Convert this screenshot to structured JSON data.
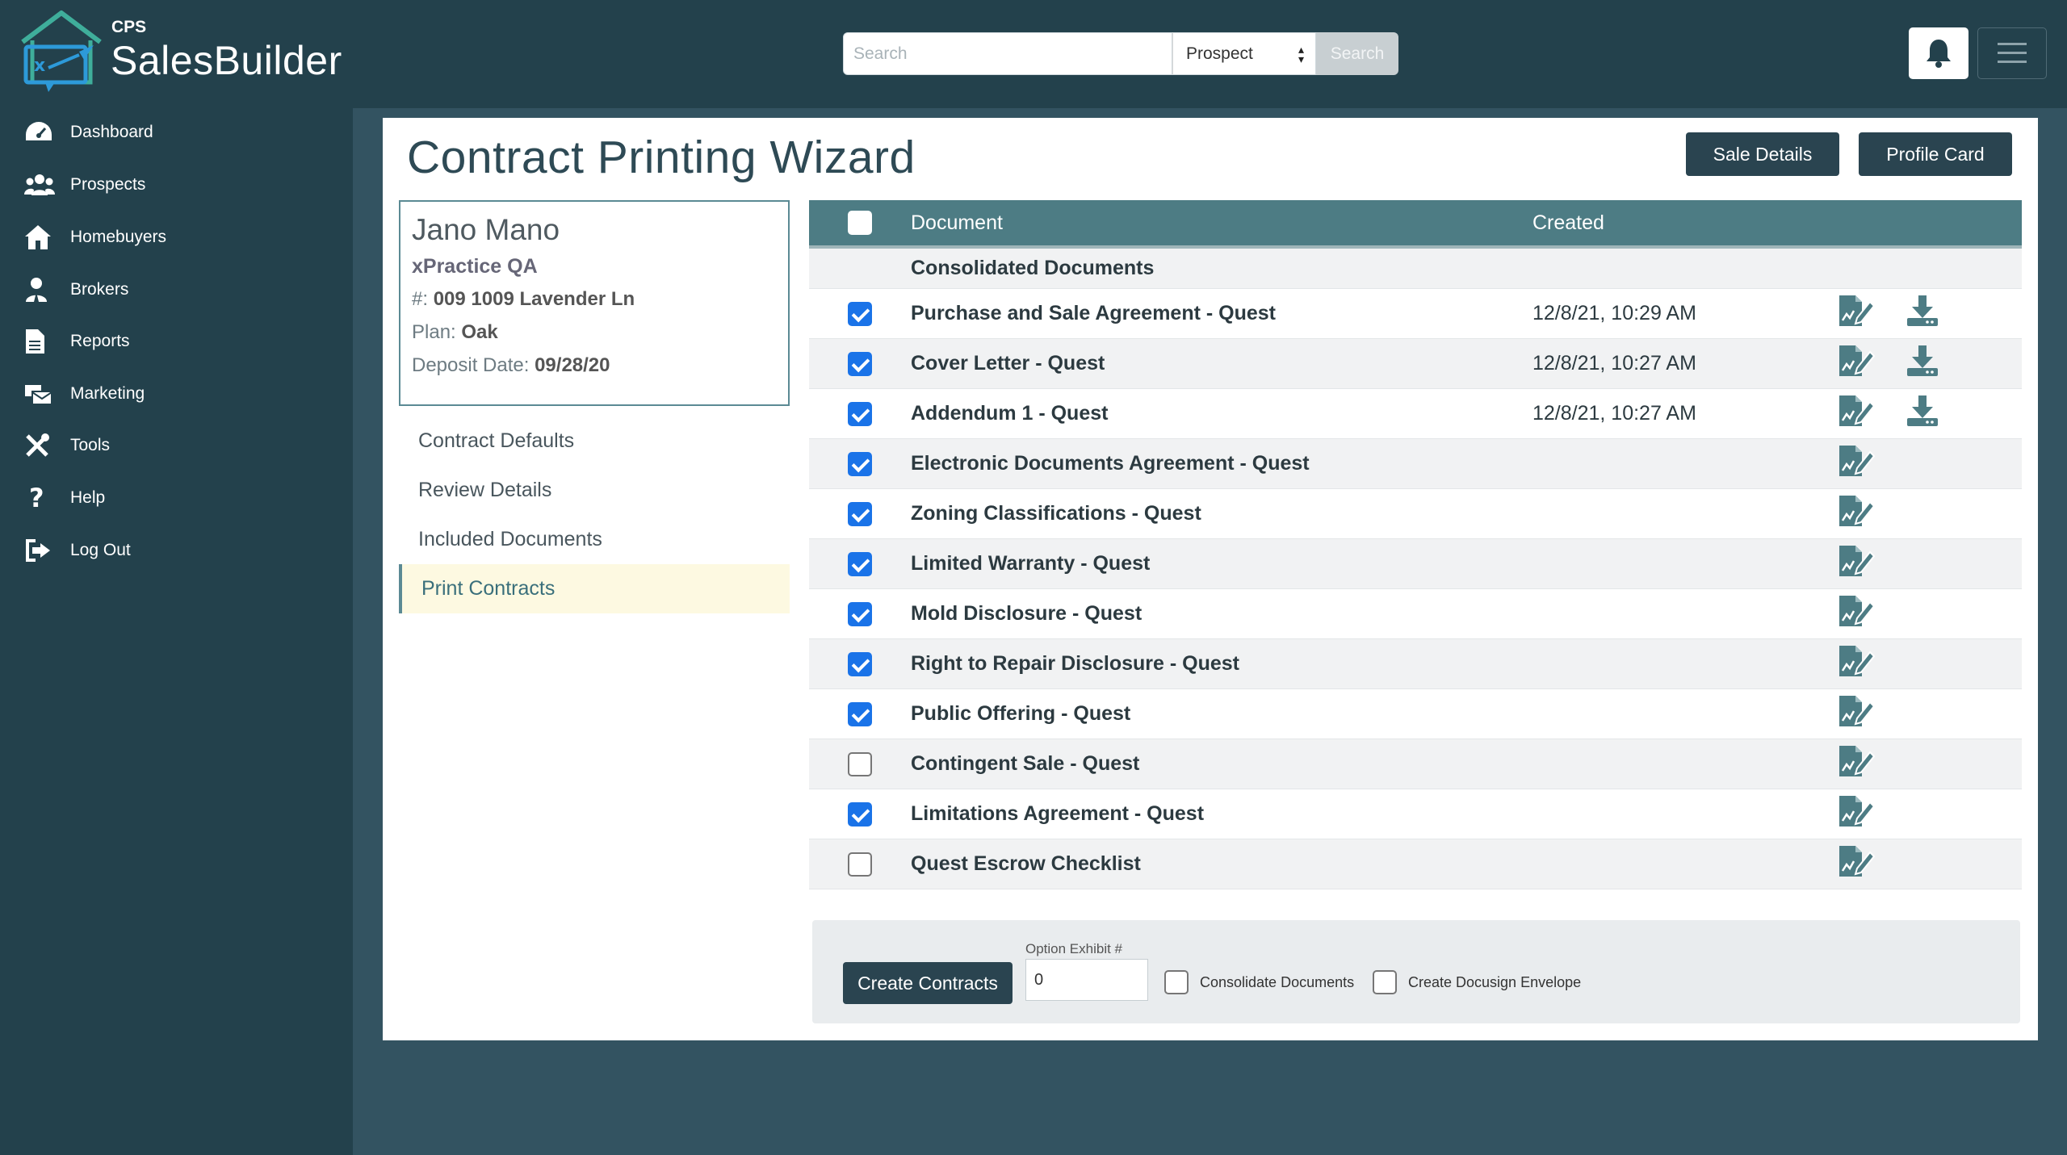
{
  "header": {
    "logo_small": "CPS",
    "logo_brand": "SalesBuilder",
    "search_placeholder": "Search",
    "search_scope": "Prospect",
    "search_button": "Search"
  },
  "sidebar": {
    "items": [
      {
        "label": "Dashboard",
        "icon": "dashboard-icon"
      },
      {
        "label": "Prospects",
        "icon": "users-icon"
      },
      {
        "label": "Homebuyers",
        "icon": "house-icon"
      },
      {
        "label": "Brokers",
        "icon": "user-tie-icon"
      },
      {
        "label": "Reports",
        "icon": "file-icon"
      },
      {
        "label": "Marketing",
        "icon": "mail-bulk-icon"
      },
      {
        "label": "Tools",
        "icon": "tools-icon"
      },
      {
        "label": "Help",
        "icon": "question-icon"
      },
      {
        "label": "Log Out",
        "icon": "sign-out-icon"
      }
    ]
  },
  "page": {
    "title": "Contract Printing Wizard",
    "sale_details_button": "Sale Details",
    "profile_card_button": "Profile Card"
  },
  "customer": {
    "name": "Jano Mano",
    "company": "xPractice QA",
    "lot_prefix": "#: ",
    "lot": "009 1009 Lavender Ln",
    "plan_prefix": "Plan: ",
    "plan": "Oak",
    "deposit_prefix": "Deposit Date: ",
    "deposit_date": "09/28/20"
  },
  "steps": [
    {
      "label": "Contract Defaults",
      "active": false
    },
    {
      "label": "Review Details",
      "active": false
    },
    {
      "label": "Included Documents",
      "active": false
    },
    {
      "label": "Print Contracts",
      "active": true
    }
  ],
  "table": {
    "col_document": "Document",
    "col_created": "Created",
    "group_label": "Consolidated Documents",
    "rows": [
      {
        "document": "Purchase and Sale Agreement - Quest",
        "created": "12/8/21, 10:29 AM",
        "checked": true,
        "download": true
      },
      {
        "document": "Cover Letter - Quest",
        "created": "12/8/21, 10:27 AM",
        "checked": true,
        "download": true
      },
      {
        "document": "Addendum 1 - Quest",
        "created": "12/8/21, 10:27 AM",
        "checked": true,
        "download": true
      },
      {
        "document": "Electronic Documents Agreement - Quest",
        "created": "",
        "checked": true,
        "download": false
      },
      {
        "document": "Zoning Classifications - Quest",
        "created": "",
        "checked": true,
        "download": false
      },
      {
        "document": "Limited Warranty - Quest",
        "created": "",
        "checked": true,
        "download": false
      },
      {
        "document": "Mold Disclosure - Quest",
        "created": "",
        "checked": true,
        "download": false
      },
      {
        "document": "Right to Repair Disclosure - Quest",
        "created": "",
        "checked": true,
        "download": false
      },
      {
        "document": "Public Offering - Quest",
        "created": "",
        "checked": true,
        "download": false
      },
      {
        "document": "Contingent Sale - Quest",
        "created": "",
        "checked": false,
        "download": false
      },
      {
        "document": "Limitations Agreement - Quest",
        "created": "",
        "checked": true,
        "download": false
      },
      {
        "document": "Quest Escrow Checklist",
        "created": "",
        "checked": false,
        "download": false
      }
    ]
  },
  "actions": {
    "create_button": "Create Contracts",
    "option_exhibit_label": "Option Exhibit #",
    "option_exhibit_value": "0",
    "consolidate_label": "Consolidate Documents",
    "docusign_label": "Create Docusign Envelope"
  },
  "colors": {
    "topbar": "#23414c",
    "background": "#335361",
    "table_header": "#4d7c84",
    "button": "#2a4450",
    "checkbox": "#1a73e8",
    "icon_teal": "#4d7c84"
  }
}
